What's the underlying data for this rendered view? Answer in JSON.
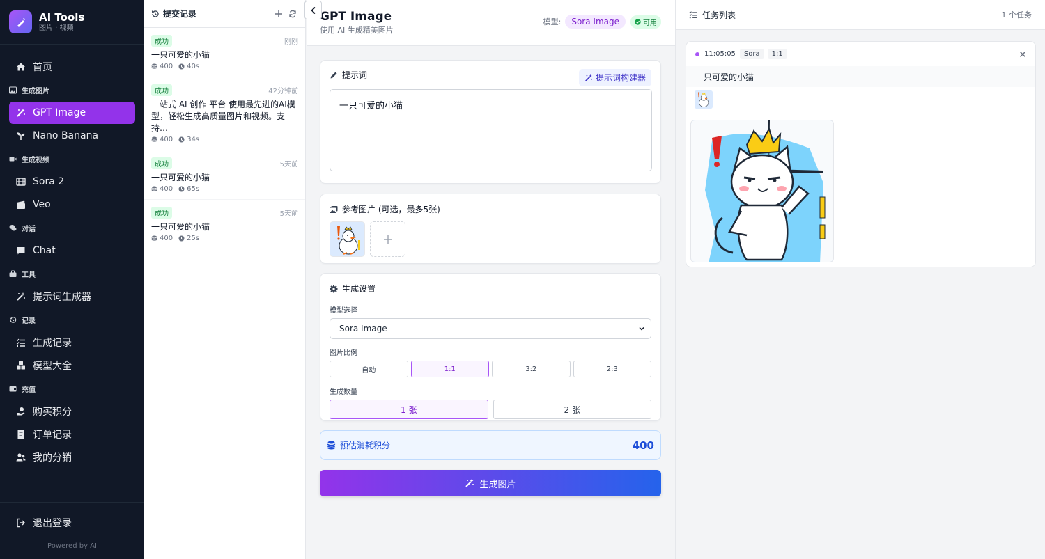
{
  "brand": {
    "title": "AI Tools",
    "subtitle": "图片 · 视频"
  },
  "nav": {
    "home": "首页",
    "section_image": "生成图片",
    "gpt_image": "GPT Image",
    "nano_banana": "Nano Banana",
    "section_video": "生成视频",
    "sora2": "Sora 2",
    "veo": "Veo",
    "section_chat": "对话",
    "chat": "Chat",
    "section_tools": "工具",
    "prompt_gen": "提示词生成器",
    "section_records": "记录",
    "gen_records": "生成记录",
    "models": "模型大全",
    "section_recharge": "充值",
    "buy_points": "购买积分",
    "orders": "订单记录",
    "distribution": "我的分销",
    "logout": "退出登录",
    "powered": "Powered by AI"
  },
  "history": {
    "title": "提交记录",
    "items": [
      {
        "status": "成功",
        "time": "刚刚",
        "text": "一只可爱的小猫",
        "points": "400",
        "duration": "40s"
      },
      {
        "status": "成功",
        "time": "42分钟前",
        "text": "一站式 AI 创作 平台 使用最先进的AI模型，轻松生成高质量图片和视频。支持…",
        "points": "400",
        "duration": "34s"
      },
      {
        "status": "成功",
        "time": "5天前",
        "text": "一只可爱的小猫",
        "points": "400",
        "duration": "65s"
      },
      {
        "status": "成功",
        "time": "5天前",
        "text": "一只可爱的小猫",
        "points": "400",
        "duration": "25s"
      }
    ]
  },
  "main": {
    "title": "GPT Image",
    "subtitle": "使用 AI 生成精美图片",
    "model_label": "模型:",
    "model_name": "Sora Image",
    "status": "可用",
    "prompt_label": "提示词",
    "prompt_builder": "提示词构建器",
    "prompt_value": "一只可爱的小猫",
    "ref_label": "参考图片 (可选，最多5张)",
    "settings_label": "生成设置",
    "model_select_label": "模型选择",
    "model_select_value": "Sora Image",
    "ratio_label": "图片比例",
    "ratios": [
      "自动",
      "1:1",
      "3:2",
      "2:3"
    ],
    "count_label": "生成数量",
    "counts": [
      "1 张",
      "2 张"
    ],
    "cost_label": "预估消耗积分",
    "cost_value": "400",
    "generate": "生成图片"
  },
  "tasks": {
    "title": "任务列表",
    "count": "1 个任务",
    "item": {
      "time": "11:05:05",
      "model": "Sora",
      "ratio": "1:1",
      "prompt": "一只可爱的小猫"
    }
  },
  "colors": {
    "accent": "#9333ea",
    "sidebar": "#111827",
    "success": "#15803d",
    "cost": "#1d4ed8"
  }
}
